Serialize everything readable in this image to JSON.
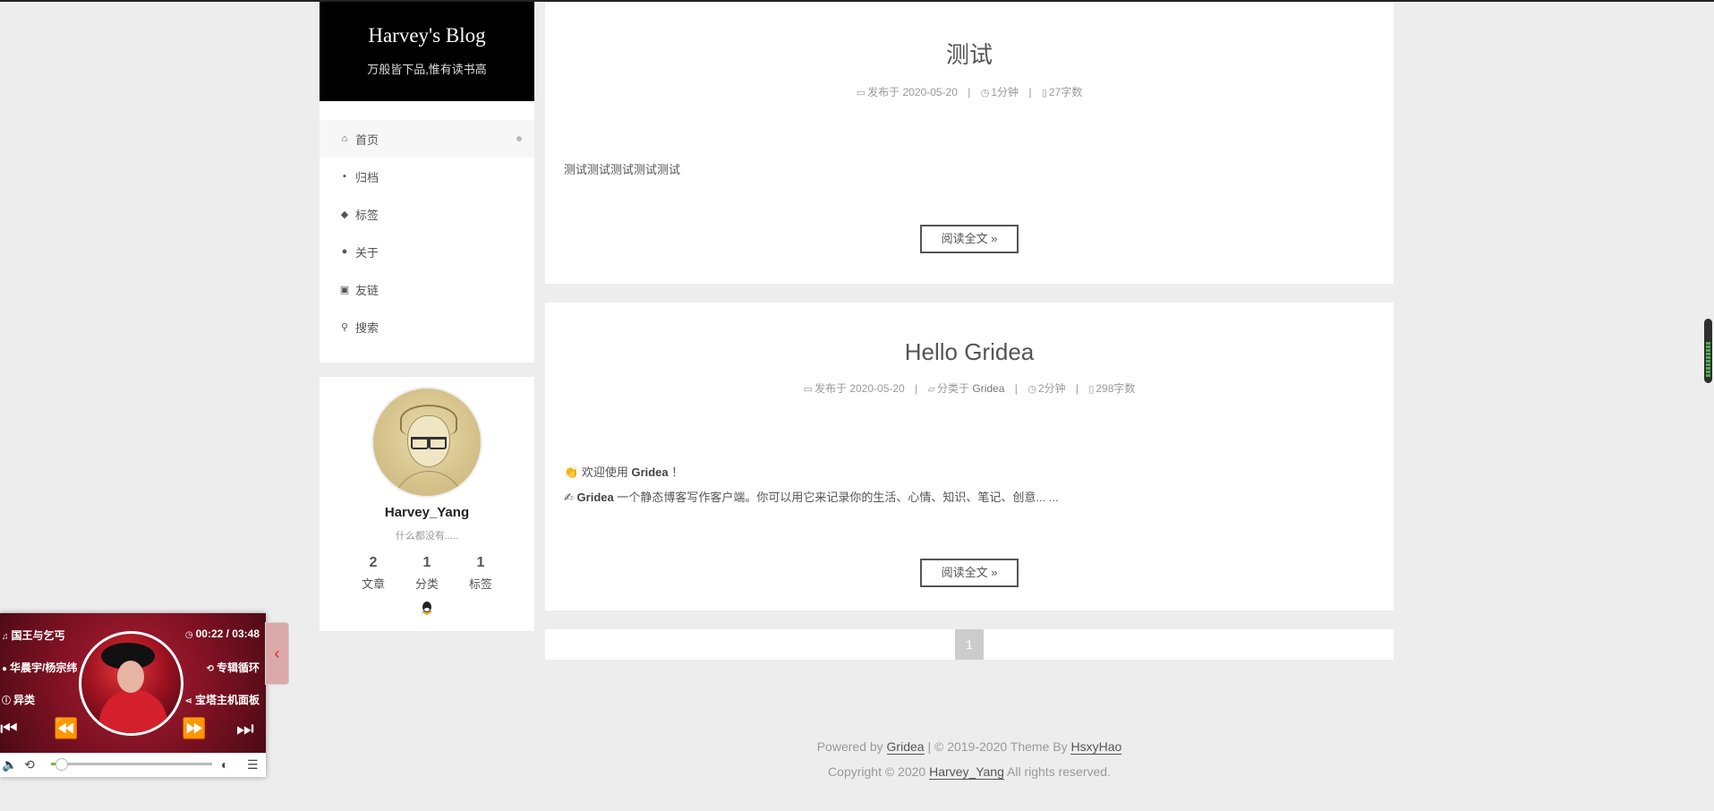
{
  "site": {
    "title": "Harvey's Blog",
    "subtitle": "万般皆下品,惟有读书高"
  },
  "menu": [
    {
      "label": "首页",
      "icon": "home-icon",
      "glyph": "⌂",
      "active": true
    },
    {
      "label": "归档",
      "icon": "archive-icon",
      "glyph": "▪",
      "active": false
    },
    {
      "label": "标签",
      "icon": "tags-icon",
      "glyph": "◆",
      "active": false
    },
    {
      "label": "关于",
      "icon": "globe-icon",
      "glyph": "●",
      "active": false
    },
    {
      "label": "友链",
      "icon": "address-book-icon",
      "glyph": "▣",
      "active": false
    },
    {
      "label": "搜索",
      "icon": "search-icon",
      "glyph": "⚲",
      "active": false
    }
  ],
  "profile": {
    "name": "Harvey_Yang",
    "description": "什么都没有.....",
    "stats": [
      {
        "num": "2",
        "label": "文章"
      },
      {
        "num": "1",
        "label": "分类"
      },
      {
        "num": "1",
        "label": "标签"
      }
    ],
    "qq_icon": "qq-icon"
  },
  "posts": [
    {
      "title": "测试",
      "meta": {
        "published": "发布于 2020-05-20",
        "read_time": "1分钟",
        "word_count": "27字数"
      },
      "excerpt": "测试测试测试测试测试",
      "read_more": "阅读全文 »"
    },
    {
      "title": "Hello Gridea",
      "meta": {
        "published": "发布于 2020-05-20",
        "category_prefix": "分类于",
        "category": "Gridea",
        "read_time": "2分钟",
        "word_count": "298字数"
      },
      "excerpt_line1_pre": "欢迎使用",
      "excerpt_line1_bold": "Gridea",
      "excerpt_line1_post": "！",
      "excerpt_line2_bold": "Gridea",
      "excerpt_line2_post": "一个静态博客写作客户端。你可以用它来记录你的生活、心情、知识、笔记、创意... ...",
      "read_more": "阅读全文 »"
    }
  ],
  "pagination": {
    "current": "1"
  },
  "footer": {
    "powered_by": "Powered by",
    "gridea_link": "Gridea",
    "theme_text": "| © 2019-2020 Theme By",
    "theme_link": "HsxyHao",
    "copyright": "Copyright © 2020",
    "author_link": "Harvey_Yang",
    "rights": "All rights reserved."
  },
  "player": {
    "song": "国王与乞丐",
    "time": "00:22 / 03:48",
    "artist": "华晨宇/杨宗纬",
    "loop_mode": "专辑循环",
    "album": "异类",
    "share": "宝塔主机面板",
    "progress": 0.1
  }
}
